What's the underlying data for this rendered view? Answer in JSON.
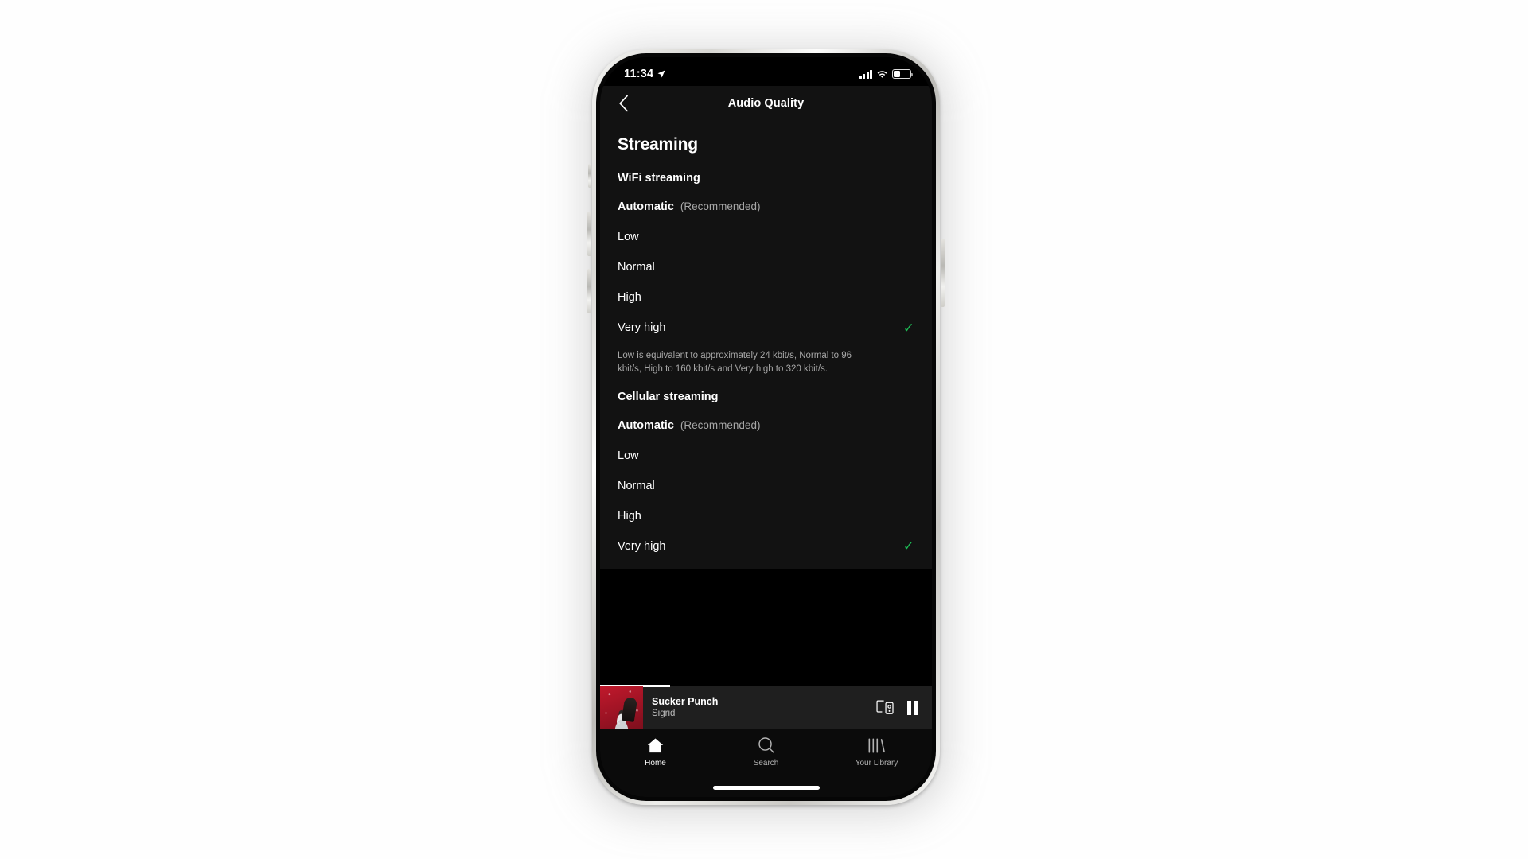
{
  "statusbar": {
    "time": "11:34",
    "location_icon": "location-arrow-icon",
    "signal_icon": "cellular-signal-icon",
    "wifi_icon": "wifi-icon",
    "battery_icon": "battery-icon"
  },
  "navbar": {
    "back_icon": "chevron-left-icon",
    "title": "Audio Quality"
  },
  "page": {
    "section_title": "Streaming",
    "wifi_heading": "WiFi streaming",
    "cellular_heading": "Cellular streaming",
    "description": "Low is equivalent to approximately 24 kbit/s, Normal to 96 kbit/s, High to 160 kbit/s and Very high to 320 kbit/s.",
    "recommended_label": "(Recommended)",
    "check_glyph": "✓",
    "accent_green": "#1db954",
    "wifi_options": [
      {
        "label": "Automatic",
        "recommended": true,
        "selected": false
      },
      {
        "label": "Low",
        "recommended": false,
        "selected": false
      },
      {
        "label": "Normal",
        "recommended": false,
        "selected": false
      },
      {
        "label": "High",
        "recommended": false,
        "selected": false
      },
      {
        "label": "Very high",
        "recommended": false,
        "selected": true
      }
    ],
    "cellular_options": [
      {
        "label": "Automatic",
        "recommended": true,
        "selected": false
      },
      {
        "label": "Low",
        "recommended": false,
        "selected": false
      },
      {
        "label": "Normal",
        "recommended": false,
        "selected": false
      },
      {
        "label": "High",
        "recommended": false,
        "selected": false
      },
      {
        "label": "Very high",
        "recommended": false,
        "selected": true
      }
    ]
  },
  "now_playing": {
    "track": "Sucker Punch",
    "artist": "Sigrid",
    "album_art": "sucker-punch-album-art",
    "devices_icon": "connect-to-device-icon",
    "pause_icon": "pause-icon",
    "progress_percent": 21
  },
  "tabbar": {
    "items": [
      {
        "label": "Home",
        "icon": "home-icon",
        "active": true
      },
      {
        "label": "Search",
        "icon": "search-icon",
        "active": false
      },
      {
        "label": "Your Library",
        "icon": "library-icon",
        "active": false
      }
    ]
  }
}
